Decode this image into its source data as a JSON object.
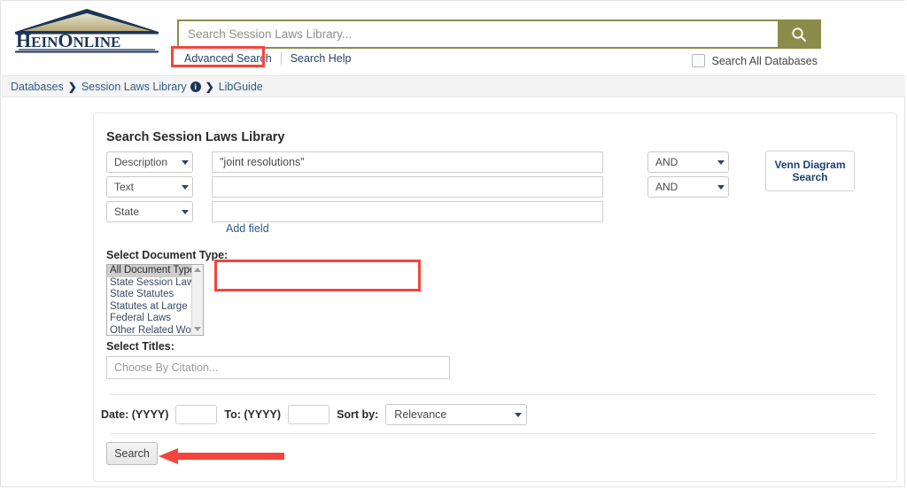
{
  "header": {
    "logo_text": "HEINONLINE",
    "search_placeholder": "Search Session Laws Library...",
    "search_value": "",
    "search_icon": "search-icon",
    "advanced_search_label": "Advanced Search",
    "search_help_label": "Search Help",
    "all_databases_label": "Search All Databases",
    "all_databases_checked": false,
    "accent_olive": "#8b8c4a",
    "highlight_red": "#f4453c"
  },
  "breadcrumb": {
    "items": [
      {
        "label": "Databases"
      },
      {
        "label": "Session Laws Library",
        "info_icon": "info-icon"
      },
      {
        "label": "LibGuide"
      }
    ],
    "separator": "❯"
  },
  "panel": {
    "title": "Search Session Laws Library",
    "field_rows": [
      {
        "field": "Description",
        "value": "\"joint resolutions\"",
        "placeholder": "",
        "operator": "AND"
      },
      {
        "field": "Text",
        "value": "",
        "placeholder": "",
        "operator": "AND"
      },
      {
        "field": "State",
        "value": "",
        "placeholder": "",
        "operator": ""
      }
    ],
    "add_field_label": "Add field",
    "venn_label": "Venn Diagram Search",
    "document_type": {
      "label": "Select Document Type:",
      "options": [
        "All Document Types",
        "State Session Laws",
        "State Statutes",
        "Statutes at Large",
        "Federal Laws",
        "Other Related Works"
      ],
      "selected": "All Document Types"
    },
    "titles": {
      "label": "Select Titles:",
      "placeholder": "Choose By Citation...",
      "value": ""
    },
    "date": {
      "from_label": "Date: (YYYY)",
      "from_value": "",
      "to_label": "To: (YYYY)",
      "to_value": "",
      "sort_label": "Sort by:",
      "sort_value": "Relevance"
    },
    "search_button": "Search"
  }
}
